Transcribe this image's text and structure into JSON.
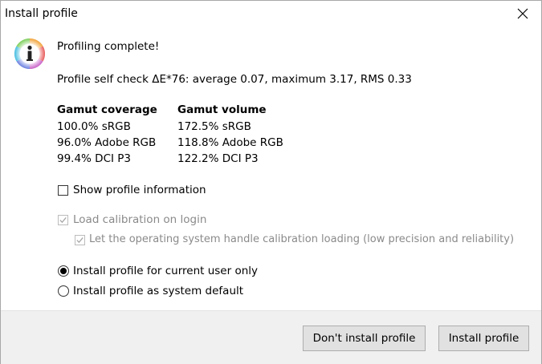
{
  "window": {
    "title": "Install profile",
    "close_icon": "close-icon"
  },
  "message": {
    "icon": "info-icon",
    "heading": "Profiling complete!",
    "self_check": "Profile self check ΔE*76: average 0.07, maximum 3.17, RMS 0.33"
  },
  "gamut": {
    "coverage": {
      "header": "Gamut coverage",
      "rows": [
        "100.0% sRGB",
        "96.0% Adobe RGB",
        "99.4% DCI P3"
      ]
    },
    "volume": {
      "header": "Gamut volume",
      "rows": [
        "172.5% sRGB",
        "118.8% Adobe RGB",
        "122.2% DCI P3"
      ]
    }
  },
  "options": {
    "show_profile_info": {
      "label": "Show profile information",
      "checked": false,
      "enabled": true
    },
    "load_calibration": {
      "label": "Load calibration on login",
      "checked": true,
      "enabled": false
    },
    "os_handle_calibration": {
      "label": "Let the operating system handle calibration loading (low precision and reliability)",
      "checked": true,
      "enabled": false
    }
  },
  "install_scope": {
    "selected": "current_user",
    "current_user_label": "Install profile for current user only",
    "system_default_label": "Install profile as system default"
  },
  "buttons": {
    "dont_install": "Don't install profile",
    "install": "Install profile"
  }
}
